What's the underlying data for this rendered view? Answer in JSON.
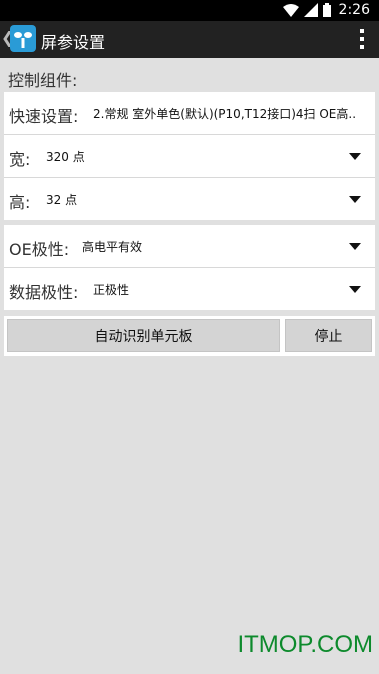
{
  "status_bar": {
    "time": "2:26"
  },
  "action_bar": {
    "title": "屏参设置"
  },
  "section": {
    "label": "控制组件:"
  },
  "settings_group_1": [
    {
      "label": "快速设置:",
      "value": "2.常规 室外单色(默认)(P10,T12接口)4扫 OE高.."
    },
    {
      "label": "宽:",
      "value": "320 点"
    },
    {
      "label": "高:",
      "value": "32 点"
    }
  ],
  "settings_group_2": [
    {
      "label": "OE极性:",
      "value": "高电平有效"
    },
    {
      "label": "数据极性:",
      "value": "正极性"
    }
  ],
  "buttons": {
    "auto_detect": "自动识别单元板",
    "stop": "停止"
  },
  "watermark": "ITMOP.COM",
  "colors": {
    "accent": "#2a9bd6",
    "watermark": "#0d8a2c"
  }
}
